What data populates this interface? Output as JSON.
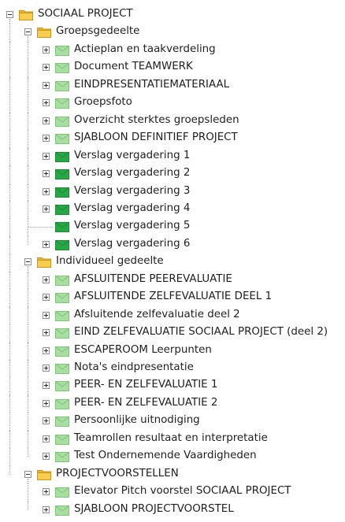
{
  "tree": {
    "label": "SOCIAAL PROJECT",
    "type": "folder",
    "expanded": true,
    "children": [
      {
        "label": "Groepsgedeelte",
        "type": "folder",
        "expanded": true,
        "children": [
          {
            "label": "Actieplan en taakverdeling",
            "type": "mail",
            "state": "read",
            "expandable": true
          },
          {
            "label": "Document TEAMWERK",
            "type": "mail",
            "state": "read",
            "expandable": true
          },
          {
            "label": "EINDPRESENTATIEMATERIAAL",
            "type": "mail",
            "state": "read",
            "expandable": true
          },
          {
            "label": "Groepsfoto",
            "type": "mail",
            "state": "read",
            "expandable": true
          },
          {
            "label": "Overzicht sterktes groepsleden",
            "type": "mail",
            "state": "read",
            "expandable": true
          },
          {
            "label": "SJABLOON DEFINITIEF PROJECT",
            "type": "mail",
            "state": "read",
            "expandable": true
          },
          {
            "label": "Verslag vergadering 1",
            "type": "mail",
            "state": "new",
            "expandable": true
          },
          {
            "label": "Verslag vergadering 2",
            "type": "mail",
            "state": "new",
            "expandable": true
          },
          {
            "label": "Verslag vergadering 3",
            "type": "mail",
            "state": "new",
            "expandable": true
          },
          {
            "label": "Verslag vergadering 4",
            "type": "mail",
            "state": "new",
            "expandable": true
          },
          {
            "label": "Verslag vergadering 5",
            "type": "mail",
            "state": "new",
            "expandable": false
          },
          {
            "label": "Verslag vergadering 6",
            "type": "mail",
            "state": "new",
            "expandable": true
          }
        ]
      },
      {
        "label": "Individueel gedeelte",
        "type": "folder",
        "expanded": true,
        "children": [
          {
            "label": "AFSLUITENDE PEEREVALUATIE",
            "type": "mail",
            "state": "read",
            "expandable": true
          },
          {
            "label": "AFSLUITENDE ZELFEVALUATIE DEEL 1",
            "type": "mail",
            "state": "read",
            "expandable": true
          },
          {
            "label": "Afsluitende zelfevaluatie deel 2",
            "type": "mail",
            "state": "read",
            "expandable": true
          },
          {
            "label": "EIND ZELFEVALUATIE SOCIAAL PROJECT (deel 2)",
            "type": "mail",
            "state": "read",
            "expandable": true
          },
          {
            "label": "ESCAPEROOM Leerpunten",
            "type": "mail",
            "state": "read",
            "expandable": true
          },
          {
            "label": "Nota's eindpresentatie",
            "type": "mail",
            "state": "read",
            "expandable": true
          },
          {
            "label": "PEER- EN ZELFEVALUATIE 1",
            "type": "mail",
            "state": "read",
            "expandable": true
          },
          {
            "label": "PEER- EN ZELFEVALUATIE 2",
            "type": "mail",
            "state": "read",
            "expandable": true
          },
          {
            "label": "Persoonlijke uitnodiging",
            "type": "mail",
            "state": "read",
            "expandable": true
          },
          {
            "label": "Teamrollen resultaat en interpretatie",
            "type": "mail",
            "state": "read",
            "expandable": true
          },
          {
            "label": "Test Ondernemende Vaardigheden",
            "type": "mail",
            "state": "read",
            "expandable": true
          }
        ]
      },
      {
        "label": "PROJECTVOORSTELLEN",
        "type": "folder",
        "expanded": true,
        "children": [
          {
            "label": "Elevator Pitch voorstel SOCIAAL PROJECT",
            "type": "mail",
            "state": "read",
            "expandable": true
          },
          {
            "label": "SJABLOON PROJECTVOORSTEL",
            "type": "mail",
            "state": "read",
            "expandable": true
          }
        ]
      }
    ]
  },
  "colors": {
    "folder_fill": "#f7cc4f",
    "folder_tab": "#eab72a",
    "folder_edge": "#c9961a",
    "mail_read_fill": "#a9dea3",
    "mail_read_edge": "#7cc676",
    "mail_new_fill": "#28a745",
    "mail_new_edge": "#1d8a36",
    "connector": "#9a9a9a"
  }
}
